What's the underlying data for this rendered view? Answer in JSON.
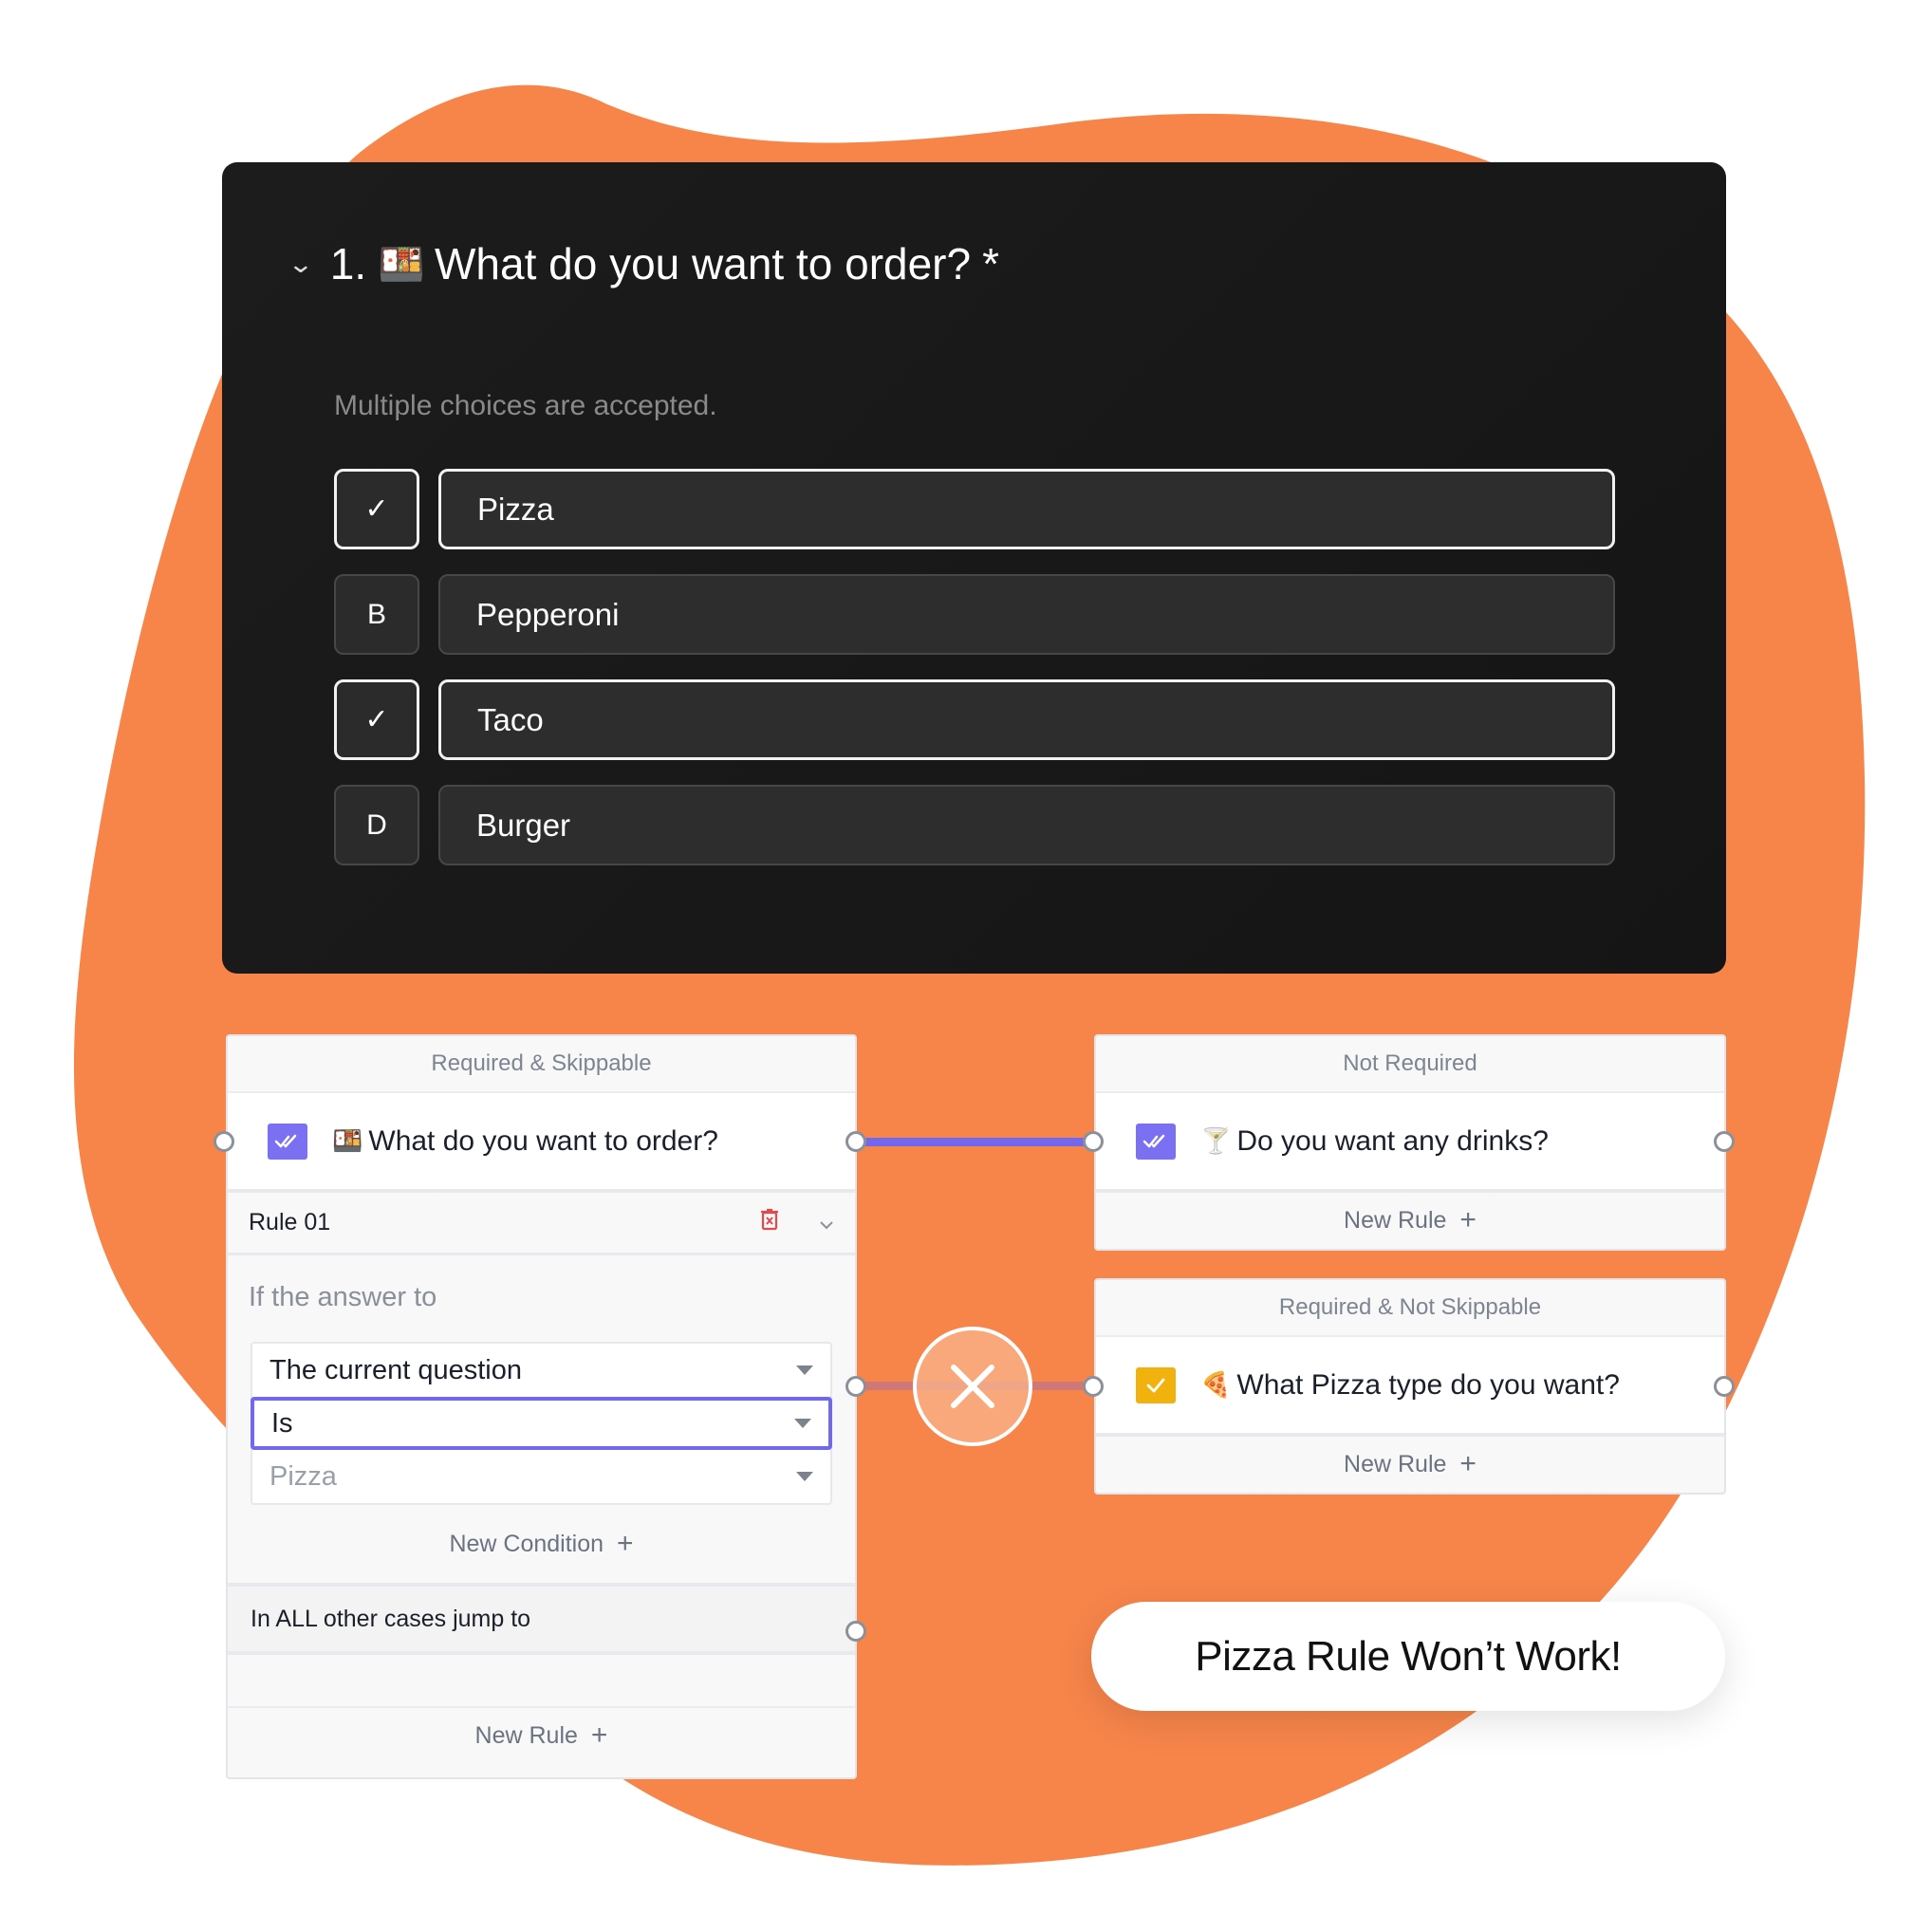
{
  "colors": {
    "blob": "#f7854a",
    "accent_purple": "#7268f0",
    "badge_yellow": "#f2b20e",
    "delete_red": "#e04b4b",
    "broken_link": "#cf7878"
  },
  "question_card": {
    "collapse_icon": "chevron-down-icon",
    "number": "1.",
    "emoji": "🍱",
    "title": "What do you want to order?",
    "required_marker": "*",
    "hint": "Multiple choices are accepted.",
    "choices": [
      {
        "key": "A",
        "label": "Pizza",
        "selected": true,
        "key_display": "✓"
      },
      {
        "key": "B",
        "label": "Pepperoni",
        "selected": false,
        "key_display": "B"
      },
      {
        "key": "C",
        "label": "Taco",
        "selected": true,
        "key_display": "✓"
      },
      {
        "key": "D",
        "label": "Burger",
        "selected": false,
        "key_display": "D"
      }
    ]
  },
  "nodes": {
    "order": {
      "header": "Required & Skippable",
      "emoji": "🍱",
      "title": "What do you want to order?",
      "badge_icon": "double-check-icon",
      "rule": {
        "name": "Rule 01",
        "delete_icon": "trash-icon",
        "collapse_icon": "chevron-down-icon",
        "if_label": "If the answer to",
        "subject": "The current question",
        "operator": "Is",
        "value_placeholder": "Pizza",
        "new_condition": "New Condition",
        "plus": "+"
      },
      "fallback": "In ALL other cases jump to",
      "new_rule": "New Rule",
      "plus": "+"
    },
    "drinks": {
      "header": "Not Required",
      "emoji": "🍸",
      "title": "Do you want any drinks?",
      "badge_icon": "double-check-icon",
      "new_rule": "New Rule",
      "plus": "+"
    },
    "pizza_type": {
      "header": "Required & Not Skippable",
      "emoji": "🍕",
      "title": "What Pizza type do you want?",
      "badge_icon": "check-icon",
      "new_rule": "New Rule",
      "plus": "+"
    }
  },
  "broken_connection_icon": "close-icon",
  "callout": "Pizza Rule Won’t Work!"
}
